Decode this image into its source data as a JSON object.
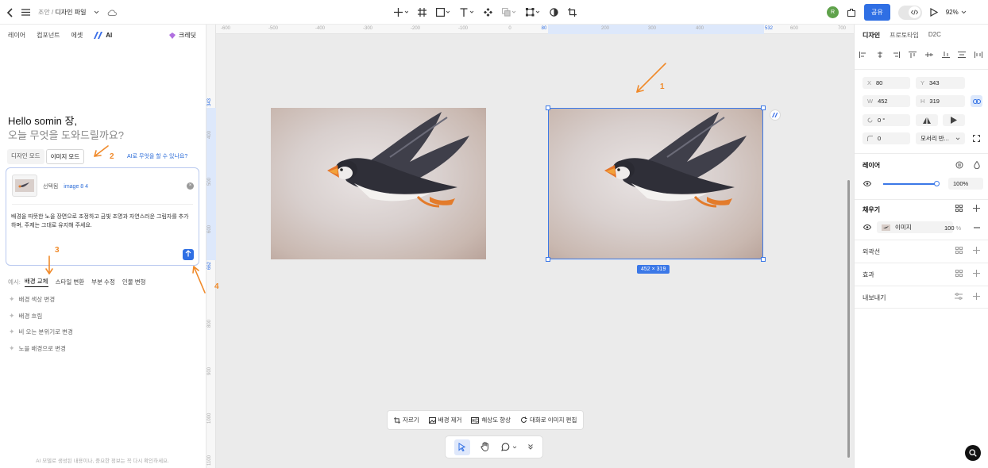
{
  "topbar": {
    "crumb_parent": "조안",
    "crumb_sep": "/",
    "crumb_file": "디자인 파일",
    "avatar": "R",
    "share": "공유",
    "zoom": "92%"
  },
  "left": {
    "tabs": [
      "레이어",
      "컴포넌트",
      "에셋"
    ],
    "ai_tab": "AI",
    "credit": "크레딧",
    "hello_line1": "Hello somin 장,",
    "hello_line2": "오늘 무엇을 도와드릴까요?",
    "mode_design": "디자인 모드",
    "mode_image": "이미지 모드",
    "can_ask": "AI로 무엇을 할 수 있나요?",
    "selected_label": "선택됨",
    "selected_name": "image 8 4",
    "prompt": "배경을 따뜻한 노을 장면으로 조정하고 금빛 조명과 자연스러운 그림자를 추가하며, 주제는 그대로 유지해 주세요.",
    "examples_label": "예시:",
    "examples": [
      "배경 교체",
      "스타일 변환",
      "부분 수정",
      "인물 변형"
    ],
    "suggestions": [
      "배경 색상 변경",
      "배경 흐림",
      "비 오는 분위기로 변경",
      "노을 배경으로 변경"
    ],
    "footnote": "AI 모델로 생성된 내용이나, 중요한 정보는 꼭 다시 확인하세요."
  },
  "canvas": {
    "ruler_h": [
      "-600",
      "-500",
      "-400",
      "-300",
      "-200",
      "-100",
      "0",
      "80",
      "200",
      "300",
      "400",
      "532",
      "600",
      "700"
    ],
    "ruler_v": [
      "343",
      "400",
      "500",
      "600",
      "662",
      "800",
      "900",
      "1000",
      "1100"
    ],
    "size_badge": "452 × 319",
    "toolbar": [
      "자르기",
      "배경 제거",
      "해상도 향상",
      "대화로 이미지 편집"
    ],
    "annotations": [
      "1",
      "2",
      "3",
      "4"
    ]
  },
  "right": {
    "tabs": [
      "디자인",
      "프로토타입",
      "D2C"
    ],
    "x_label": "X",
    "x": "80",
    "y_label": "Y",
    "y": "343",
    "w_label": "W",
    "w": "452",
    "h_label": "H",
    "h": "319",
    "rotation": "0 °",
    "radius": "0",
    "corner_mode": "모서리 반...",
    "layer_title": "레이어",
    "opacity": "100%",
    "fill_title": "채우기",
    "fill_type": "이미지",
    "fill_opacity": "100",
    "fill_pct": "%",
    "stroke_title": "외곽선",
    "effect_title": "효과",
    "export_title": "내보내기"
  }
}
